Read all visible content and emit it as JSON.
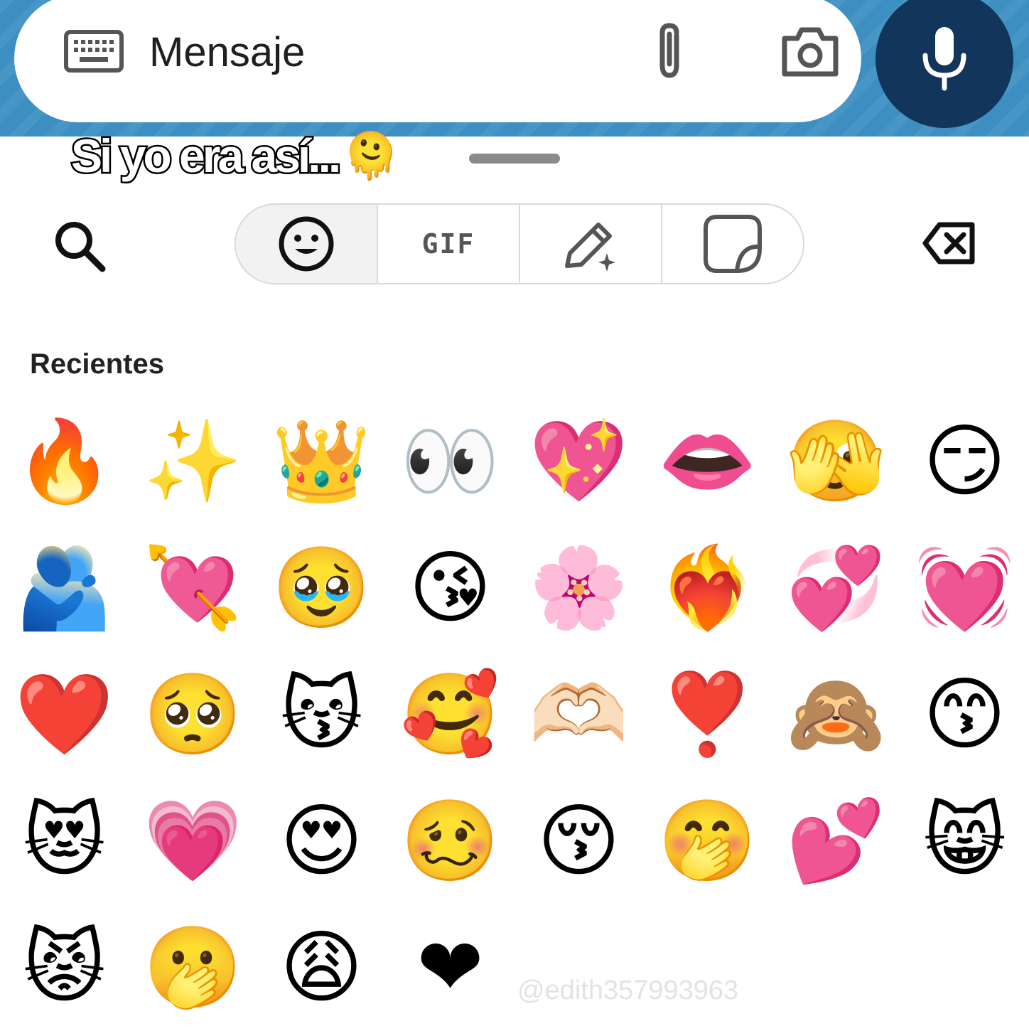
{
  "message_bar": {
    "placeholder": "Mensaje",
    "keyboard_icon": "keyboard-icon",
    "attach_icon": "paperclip-icon",
    "camera_icon": "camera-icon",
    "mic_icon": "microphone-icon"
  },
  "caption": {
    "text": "Si yo era así...",
    "emoji": "🫠"
  },
  "toolbar": {
    "search_icon": "search-icon",
    "tabs": [
      {
        "name": "emoji",
        "icon": "smiley-icon"
      },
      {
        "name": "gif",
        "label": "GIF"
      },
      {
        "name": "create",
        "icon": "pencil-sparkle-icon"
      },
      {
        "name": "stickers",
        "icon": "sticker-icon"
      }
    ],
    "backspace_icon": "backspace-icon"
  },
  "section": {
    "title": "Recientes"
  },
  "emojis": [
    "🔥",
    "✨",
    "👑",
    "👀",
    "💖",
    "👄",
    "🫣",
    "😏",
    "🫂",
    "💘",
    "🥹",
    "😘",
    "🌸",
    "❤️‍🔥",
    "💞",
    "💓",
    "❤️",
    "🥺",
    "😽",
    "🥰",
    "🫶🏻",
    "❣️",
    "🙈",
    "😙",
    "😻",
    "💗",
    "😍",
    "🥴",
    "😚",
    "🤭",
    "💕",
    "😸",
    "😾",
    "🫢",
    "😩",
    "❤"
  ],
  "watermark": "@edith357993963",
  "colors": {
    "bar_background": "#3d8fc2",
    "mic_button": "#12355b"
  }
}
